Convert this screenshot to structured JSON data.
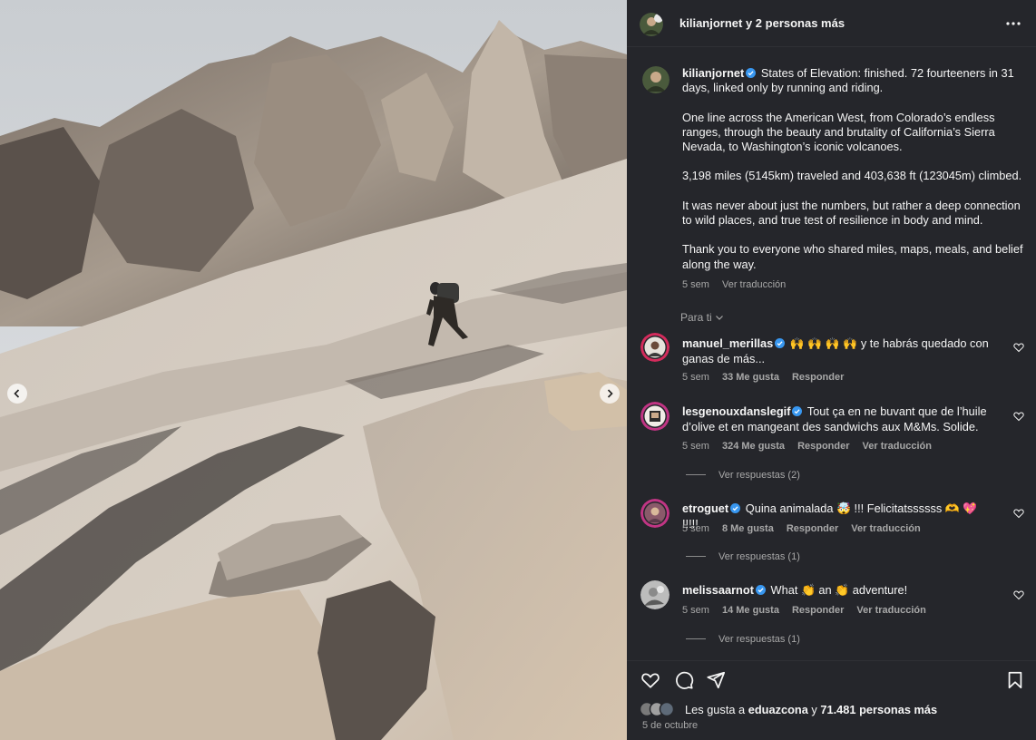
{
  "header": {
    "title": "kilianjornet y 2 personas más",
    "more_icon": "more-horizontal-icon"
  },
  "caption": {
    "username": "kilianjornet",
    "paragraphs": [
      "States of Elevation: finished. 72 fourteeners in 31 days, linked only by running and riding.",
      "One line across the American West, from Colorado’s endless ranges, through the beauty and brutality of California’s Sierra Nevada, to Washington’s iconic volcanoes.",
      "3,198 miles (5145km) traveled and 403,638 ft (123045m) climbed.",
      "It was never about just the numbers, but rather a deep connection to wild places, and true test of resilience in body and mind.",
      "Thank you to everyone who shared miles, maps, meals, and belief along the way."
    ],
    "time": "5 sem",
    "translate": "Ver traducción"
  },
  "sort_label": "Para ti",
  "comments": [
    {
      "username": "manuel_merillas",
      "text_before": "🙌 🙌 🙌 🙌 y te habrás quedado con ganas de más...",
      "time": "5 sem",
      "likes": "33 Me gusta",
      "reply": "Responder"
    },
    {
      "username": "lesgenouxdanslegif",
      "text_before": "Tout ça en ne buvant que de l’huile d’olive et en mangeant des sandwichs aux M&Ms. Solide.",
      "time": "5 sem",
      "likes": "324 Me gusta",
      "reply": "Responder",
      "translate": "Ver traducción",
      "replies": "Ver respuestas (2)"
    },
    {
      "username": "etroguet",
      "text_before": "Quina animalada 🤯 !!! Felicitatssssss 🫶 💖 !!!!!",
      "time": "5 sem",
      "likes": "8 Me gusta",
      "reply": "Responder",
      "translate": "Ver traducción",
      "replies": "Ver respuestas (1)"
    },
    {
      "username": "melissaarnot",
      "text_before": "What 👏 an 👏 adventure!",
      "time": "5 sem",
      "likes": "14 Me gusta",
      "reply": "Responder",
      "translate": "Ver traducción",
      "replies": "Ver respuestas (1)"
    }
  ],
  "likes": {
    "prefix": "Les gusta a ",
    "user": "eduazcona",
    "middle": " y ",
    "count": "71.481 personas más"
  },
  "date": "5 de octubre",
  "colors": {
    "panel_bg": "#25262b",
    "verified": "#3897f0",
    "secondary_text": "#a8a8a8"
  }
}
